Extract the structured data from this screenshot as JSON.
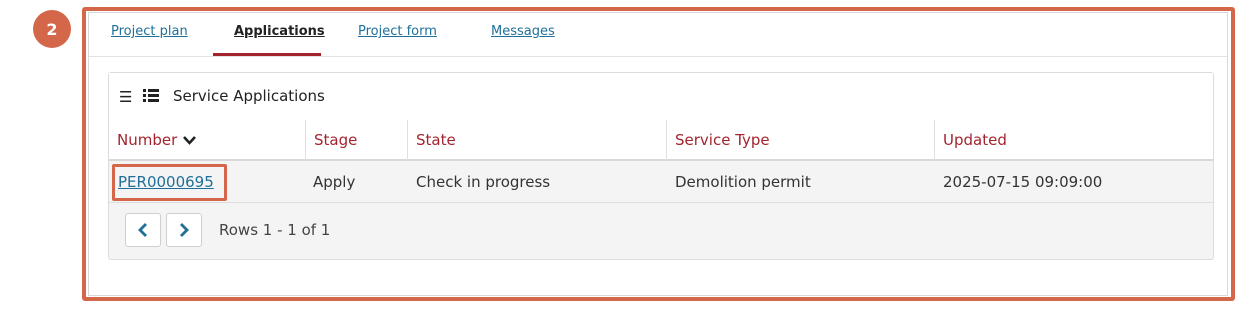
{
  "step_badge": "2",
  "tabs": [
    {
      "label": "Project plan"
    },
    {
      "label": "Applications"
    },
    {
      "label": "Project form"
    },
    {
      "label": "Messages"
    }
  ],
  "card": {
    "title": "Service Applications",
    "icons": [
      "list-icon",
      "bulleted-list-icon"
    ]
  },
  "table": {
    "columns": [
      "Number",
      "Stage",
      "State",
      "Service Type",
      "Updated"
    ],
    "sort_icon": "chevron-down-icon",
    "rows": [
      {
        "number": "PER0000695",
        "stage": "Apply",
        "state": "Check in progress",
        "service_type": "Demolition permit",
        "updated": "2025-07-15 09:09:00"
      }
    ]
  },
  "pager": {
    "prev_icon": "chevron-left-icon",
    "next_icon": "chevron-right-icon",
    "rows_info": "Rows 1 - 1 of 1"
  },
  "colors": {
    "accent_red": "#a4242e",
    "link_blue": "#1f6f9a",
    "highlight_orange": "#d4674a"
  }
}
